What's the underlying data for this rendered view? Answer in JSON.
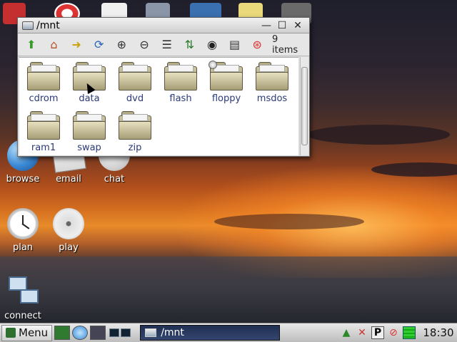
{
  "desktop": {
    "icons": [
      {
        "label": "browse",
        "icon": "globe-icon"
      },
      {
        "label": "email",
        "icon": "envelope-icon"
      },
      {
        "label": "chat",
        "icon": "chat-bubble-icon"
      },
      {
        "label": "plan",
        "icon": "clock-icon"
      },
      {
        "label": "play",
        "icon": "film-reel-icon"
      },
      {
        "label": "connect",
        "icon": "network-icon"
      }
    ]
  },
  "window": {
    "title": "/mnt",
    "controls": {
      "minimize": "—",
      "maximize": "☐",
      "close": "✕"
    },
    "toolbar": {
      "items_count": "9 items",
      "buttons": [
        {
          "name": "up-arrow-icon",
          "glyph": "⬆"
        },
        {
          "name": "home-icon",
          "glyph": "⌂"
        },
        {
          "name": "go-icon",
          "glyph": "➜"
        },
        {
          "name": "refresh-icon",
          "glyph": "⟳"
        },
        {
          "name": "zoom-in-icon",
          "glyph": "⊕"
        },
        {
          "name": "zoom-out-icon",
          "glyph": "⊖"
        },
        {
          "name": "list-view-icon",
          "glyph": "☰"
        },
        {
          "name": "sort-az-icon",
          "glyph": "⇅"
        },
        {
          "name": "eye-icon",
          "glyph": "◉"
        },
        {
          "name": "details-view-icon",
          "glyph": "▤"
        },
        {
          "name": "lifebuoy-icon",
          "glyph": "⊛"
        }
      ]
    },
    "files": [
      {
        "label": "cdrom"
      },
      {
        "label": "data"
      },
      {
        "label": "dvd"
      },
      {
        "label": "flash"
      },
      {
        "label": "floppy"
      },
      {
        "label": "msdos"
      },
      {
        "label": "ram1"
      },
      {
        "label": "swap"
      },
      {
        "label": "zip"
      }
    ]
  },
  "taskbar": {
    "menu_label": "Menu",
    "task_label": "/mnt",
    "clock": "18:30"
  },
  "colors": {
    "taskbar_active": "#1f2e52",
    "file_label": "#2a3a78"
  }
}
